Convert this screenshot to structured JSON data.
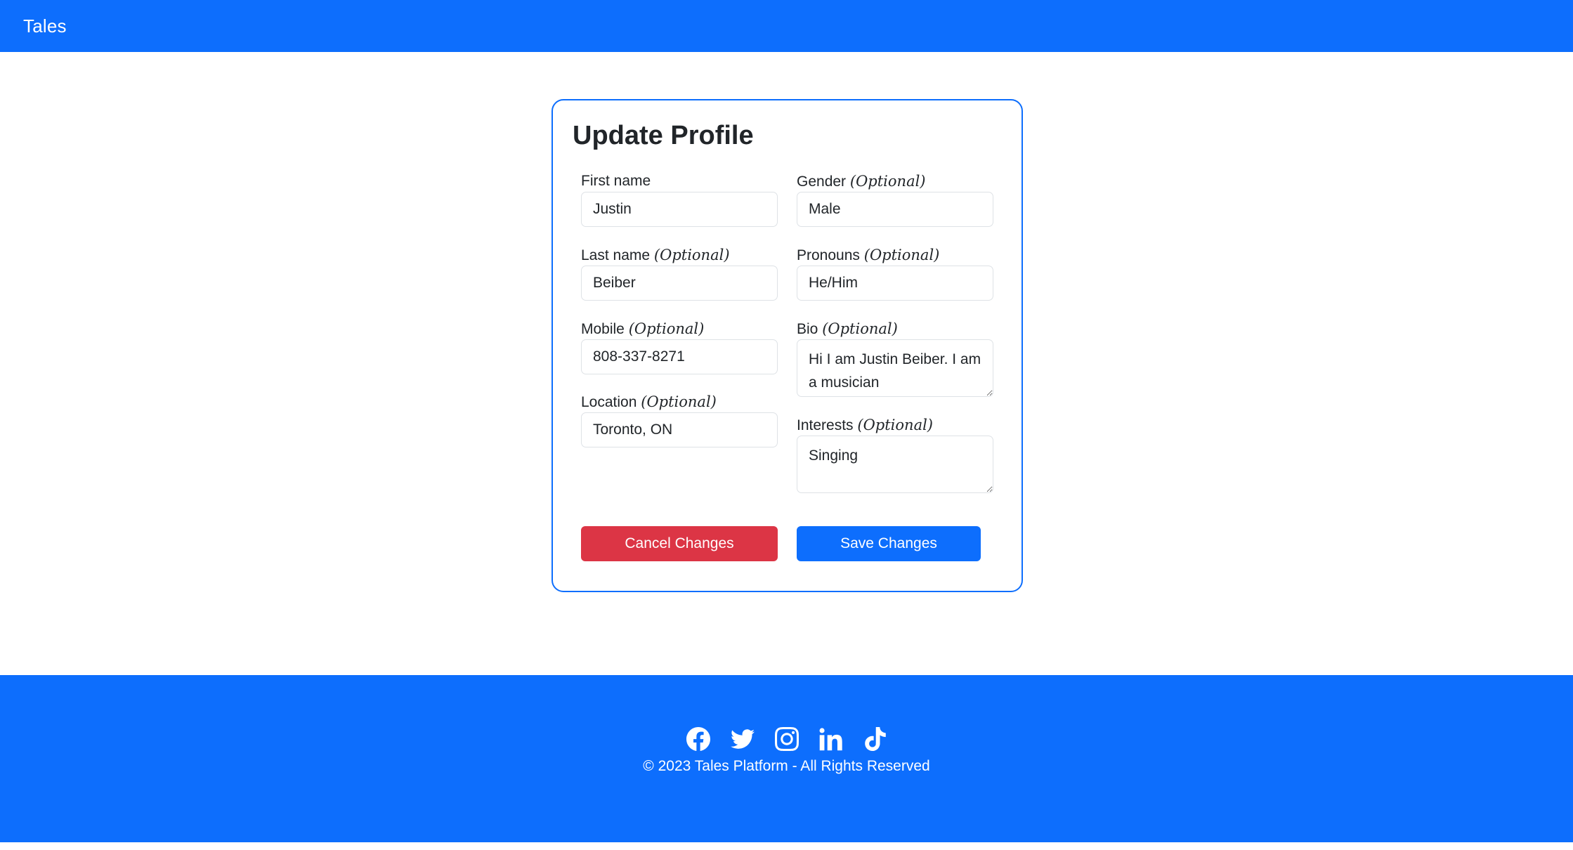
{
  "navbar": {
    "brand": "Tales"
  },
  "form": {
    "title": "Update Profile",
    "optional_marker": "(Optional)",
    "fields": {
      "first_name": {
        "label": "First name",
        "value": "Justin"
      },
      "last_name": {
        "label": "Last name",
        "value": "Beiber"
      },
      "mobile": {
        "label": "Mobile",
        "value": "808-337-8271"
      },
      "location": {
        "label": "Location",
        "value": "Toronto, ON"
      },
      "gender": {
        "label": "Gender",
        "value": "Male"
      },
      "pronouns": {
        "label": "Pronouns",
        "value": "He/Him"
      },
      "bio": {
        "label": "Bio",
        "value": "Hi I am Justin Beiber. I am a musician"
      },
      "interests": {
        "label": "Interests",
        "value": "Singing"
      }
    },
    "cancel_label": "Cancel Changes",
    "save_label": "Save Changes"
  },
  "footer": {
    "icons": [
      "facebook-icon",
      "twitter-icon",
      "instagram-icon",
      "linkedin-icon",
      "tiktok-icon"
    ],
    "copyright": "© 2023 Tales Platform - All Rights Reserved"
  },
  "colors": {
    "primary": "#0d6efd",
    "danger": "#dc3545",
    "text": "#212529"
  }
}
